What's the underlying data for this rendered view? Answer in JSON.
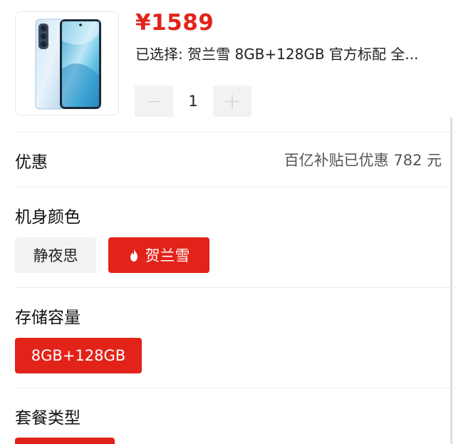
{
  "product": {
    "price": "¥1589",
    "selected_text": "已选择: 贺兰雪 8GB+128GB 官方标配 全...",
    "quantity": "1",
    "minus_symbol": "−",
    "plus_symbol": "+"
  },
  "promo": {
    "label": "优惠",
    "value": "百亿补贴已优惠 782 元"
  },
  "color_section": {
    "title": "机身颜色",
    "options": [
      {
        "label": "静夜思",
        "selected": false
      },
      {
        "label": "贺兰雪",
        "selected": true,
        "icon": "flame-icon"
      }
    ]
  },
  "storage_section": {
    "title": "存储容量",
    "options": [
      {
        "label": "8GB+128GB",
        "selected": true
      }
    ]
  },
  "package_section": {
    "title": "套餐类型"
  },
  "colors": {
    "accent": "#e2231a",
    "chip_gray": "#f2f2f2",
    "divider": "#ececec"
  }
}
